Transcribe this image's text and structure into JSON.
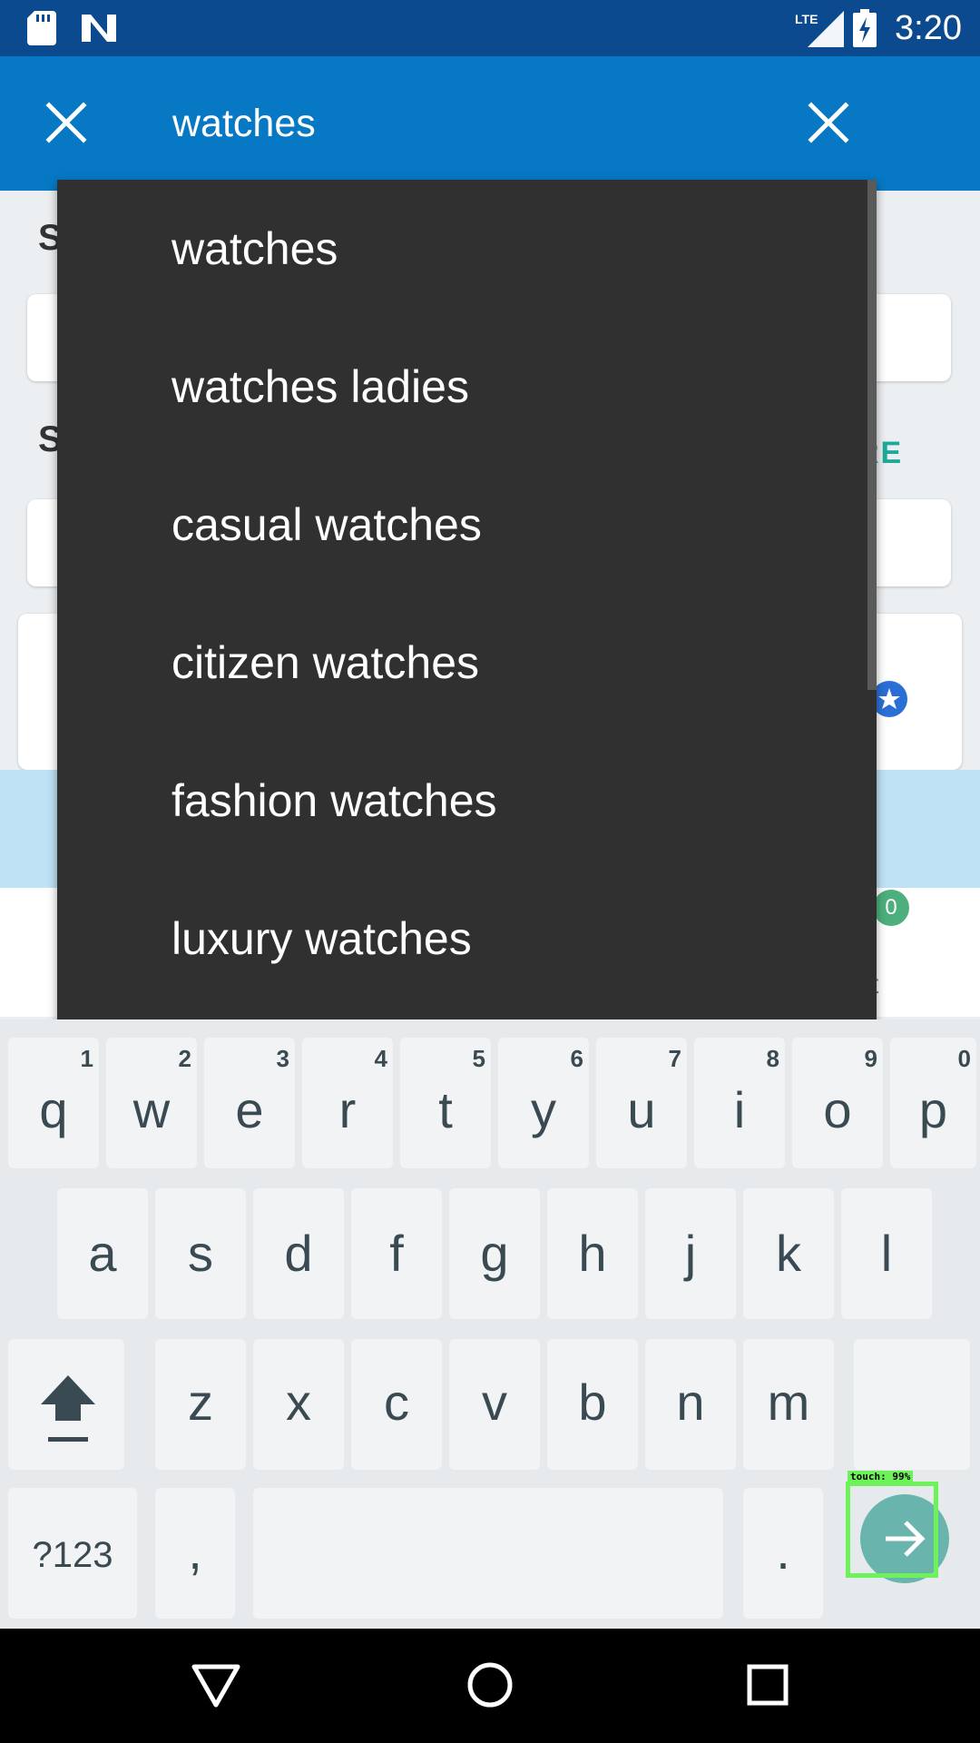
{
  "status_bar": {
    "time": "3:20",
    "network": "LTE",
    "icons": [
      "sd-card-icon",
      "n-notification-icon",
      "lte-signal-icon",
      "battery-charging-icon"
    ]
  },
  "app_bar": {
    "search_query": "watches",
    "close_icon": "close-icon",
    "clear_icon": "clear-icon"
  },
  "background": {
    "label_1": "S",
    "label_2": "S",
    "more_link": "RE",
    "badge_count": "0",
    "partial_text": "t"
  },
  "suggestions": [
    {
      "label": "watches"
    },
    {
      "label": "watches ladies"
    },
    {
      "label": "casual watches"
    },
    {
      "label": "citizen watches"
    },
    {
      "label": "fashion watches"
    },
    {
      "label": "luxury watches"
    }
  ],
  "keyboard": {
    "row1": [
      {
        "key": "q",
        "hint": "1"
      },
      {
        "key": "w",
        "hint": "2"
      },
      {
        "key": "e",
        "hint": "3"
      },
      {
        "key": "r",
        "hint": "4"
      },
      {
        "key": "t",
        "hint": "5"
      },
      {
        "key": "y",
        "hint": "6"
      },
      {
        "key": "u",
        "hint": "7"
      },
      {
        "key": "i",
        "hint": "8"
      },
      {
        "key": "o",
        "hint": "9"
      },
      {
        "key": "p",
        "hint": "0"
      }
    ],
    "row2": [
      "a",
      "s",
      "d",
      "f",
      "g",
      "h",
      "j",
      "k",
      "l"
    ],
    "row3": [
      "z",
      "x",
      "c",
      "v",
      "b",
      "n",
      "m"
    ],
    "symbols_key": "?123",
    "comma_key": ",",
    "period_key": ".",
    "shift_icon": "shift-icon",
    "go_icon": "arrow-right-icon"
  },
  "overlay": {
    "touch_label": "touch: 99%"
  },
  "nav_bar": {
    "back": "back-triangle-icon",
    "home": "home-circle-icon",
    "recent": "recent-square-icon"
  }
}
